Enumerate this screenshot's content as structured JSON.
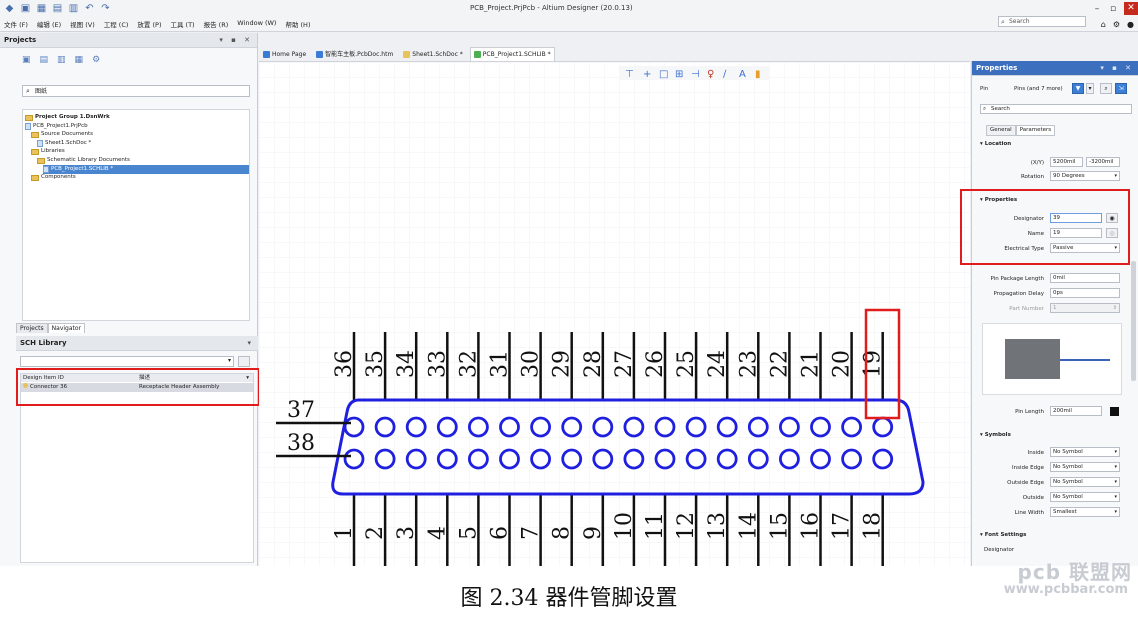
{
  "window": {
    "title": "PCB_Project.PrjPcb - Altium Designer (20.0.13)",
    "search_placeholder": "Search"
  },
  "menubar": [
    "文件 (F)",
    "编辑 (E)",
    "视图 (V)",
    "工程 (C)",
    "放置 (P)",
    "工具 (T)",
    "报告 (R)",
    "Window (W)",
    "帮助 (H)"
  ],
  "projects_panel": {
    "title": "Projects",
    "search_value": "图纸",
    "tree": [
      {
        "label": "Project Group 1.DsnWrk",
        "level": 0,
        "kind": "group"
      },
      {
        "label": "PCB_Project1.PrjPcb",
        "level": 0,
        "kind": "project"
      },
      {
        "label": "Source Documents",
        "level": 1,
        "kind": "folder"
      },
      {
        "label": "Sheet1.SchDoc *",
        "level": 2,
        "kind": "doc"
      },
      {
        "label": "Libraries",
        "level": 1,
        "kind": "folder"
      },
      {
        "label": "Schematic Library Documents",
        "level": 2,
        "kind": "folder"
      },
      {
        "label": "PCB_Project1.SCHLIB *",
        "level": 3,
        "kind": "doc",
        "selected": true
      },
      {
        "label": "Components",
        "level": 1,
        "kind": "folder"
      }
    ],
    "tabs": [
      "Projects",
      "Navigator"
    ]
  },
  "schlib_panel": {
    "title": "SCH Library",
    "columns": [
      "Design Item ID",
      "描述"
    ],
    "rows": [
      {
        "id": "Connector 36",
        "description": "Receptacle Header Assembly"
      }
    ]
  },
  "doc_tabs": [
    {
      "label": "Home Page",
      "color": "#3a7bd5"
    },
    {
      "label": "智能车主板.PcbDoc.htm",
      "color": "#3a7bd5"
    },
    {
      "label": "Sheet1.SchDoc *",
      "color": "#e8c35a"
    },
    {
      "label": "PCB_Project1.SCHLIB *",
      "color": "#4caf50",
      "active": true
    }
  ],
  "schematic": {
    "top_pins": [
      "36",
      "35",
      "34",
      "33",
      "32",
      "31",
      "30",
      "29",
      "28",
      "27",
      "26",
      "25",
      "24",
      "23",
      "22",
      "21",
      "20",
      "19"
    ],
    "bottom_pins": [
      "1",
      "2",
      "3",
      "4",
      "5",
      "6",
      "7",
      "8",
      "9",
      "10",
      "11",
      "12",
      "13",
      "14",
      "15",
      "16",
      "17",
      "18"
    ],
    "left_pins": [
      "37",
      "38"
    ],
    "body_color": "#1f1fe0"
  },
  "properties_panel": {
    "title": "Properties",
    "filter_label": "Pin",
    "filter_value": "Pins (and 7 more)",
    "search_placeholder": "Search",
    "tabs": [
      "General",
      "Parameters"
    ],
    "location": {
      "section": "Location",
      "xy_label": "(X/Y)",
      "x": "5200mil",
      "y": "-3200mil",
      "rotation_label": "Rotation",
      "rotation": "90 Degrees"
    },
    "properties": {
      "section": "Properties",
      "designator_label": "Designator",
      "designator": "39",
      "name_label": "Name",
      "name": "19",
      "electrical_type_label": "Electrical Type",
      "electrical_type": "Passive"
    },
    "package": {
      "pin_package_length_label": "Pin Package Length",
      "pin_package_length": "0mil",
      "propagation_delay_label": "Propagation Delay",
      "propagation_delay": "0ps",
      "part_number_label": "Part Number",
      "part_number": "1"
    },
    "pin_length_label": "Pin Length",
    "pin_length": "200mil",
    "symbols": {
      "section": "Symbols",
      "rows": [
        {
          "label": "Inside",
          "value": "No Symbol"
        },
        {
          "label": "Inside Edge",
          "value": "No Symbol"
        },
        {
          "label": "Outside Edge",
          "value": "No Symbol"
        },
        {
          "label": "Outside",
          "value": "No Symbol"
        },
        {
          "label": "Line Width",
          "value": "Smallest"
        }
      ]
    },
    "font_settings": {
      "section": "Font Settings",
      "designator_label": "Designator"
    }
  },
  "caption": "图 2.34 器件管脚设置",
  "watermark": {
    "logo": "pcb 联盟网",
    "url": "www.pcbbar.com"
  }
}
